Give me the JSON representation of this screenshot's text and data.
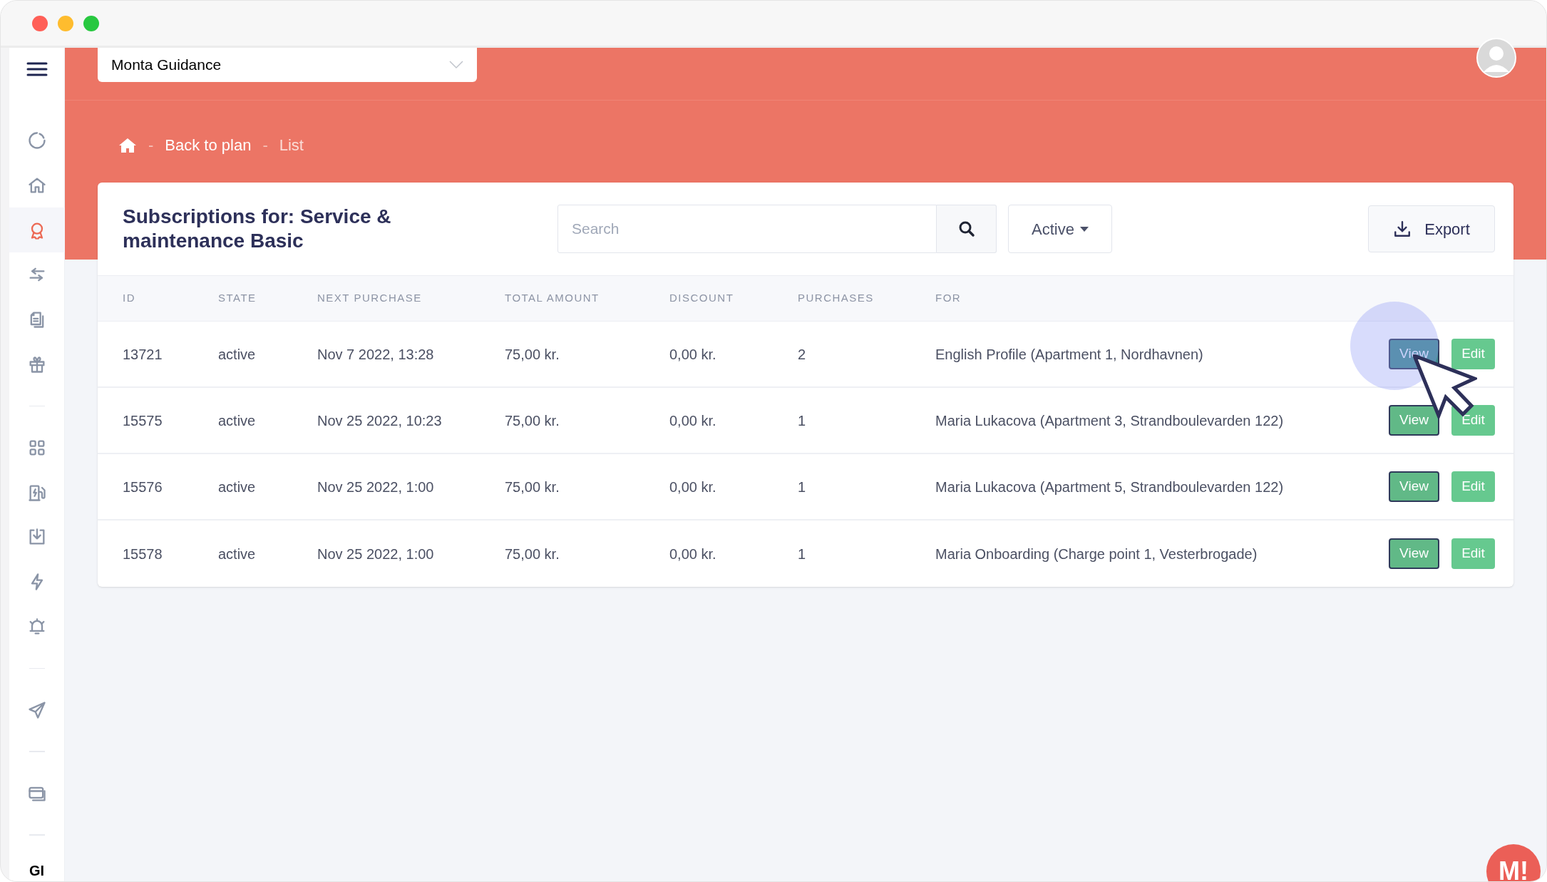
{
  "window": {
    "controls": [
      {
        "color": "#ff5f57"
      },
      {
        "color": "#febc2e"
      },
      {
        "color": "#28c840"
      }
    ]
  },
  "sidebar": {
    "items": [
      {
        "kind": "link",
        "selected": false
      },
      {
        "kind": "link",
        "selected": false
      },
      {
        "kind": "link",
        "selected": true
      },
      {
        "kind": "link",
        "selected": false
      },
      {
        "kind": "link",
        "selected": false
      },
      {
        "kind": "link",
        "selected": false
      },
      {
        "kind": "divider"
      },
      {
        "kind": "link",
        "selected": false
      },
      {
        "kind": "link",
        "selected": false
      },
      {
        "kind": "link",
        "selected": false
      },
      {
        "kind": "link",
        "selected": false
      },
      {
        "kind": "link",
        "selected": false
      },
      {
        "kind": "divider"
      },
      {
        "kind": "link",
        "selected": false
      },
      {
        "kind": "divider"
      },
      {
        "kind": "link",
        "selected": false
      },
      {
        "kind": "divider"
      },
      {
        "kind": "label",
        "label": "GI"
      }
    ]
  },
  "top_bar": {
    "project_select": {
      "value": "Monta Guidance"
    }
  },
  "breadcrumb": {
    "separator": "-",
    "items": [
      {
        "label": "Back to plan",
        "kind": "link"
      },
      {
        "label": "List",
        "kind": "current"
      }
    ]
  },
  "card": {
    "title": "Subscriptions for: Service & maintenance Basic",
    "search": {
      "placeholder": "Search"
    },
    "filter": {
      "label": "Active"
    },
    "export": {
      "label": "Export"
    }
  },
  "table": {
    "columns": [
      "ID",
      "STATE",
      "NEXT PURCHASE",
      "TOTAL AMOUNT",
      "DISCOUNT",
      "PURCHASES",
      "FOR"
    ],
    "rows": [
      {
        "cells": [
          "13721",
          "active",
          "Nov 7 2022, 13:28",
          "75,00 kr.",
          "0,00 kr.",
          "2",
          "English Profile (Apartment 1, Nordhavnen)"
        ],
        "view": {
          "label": "View",
          "hovered": true
        },
        "edit": {
          "label": "Edit"
        }
      },
      {
        "cells": [
          "15575",
          "active",
          "Nov 25 2022, 10:23",
          "75,00 kr.",
          "0,00 kr.",
          "1",
          "Maria Lukacova (Apartment 3, Strandboulevarden 122)"
        ],
        "view": {
          "label": "View",
          "hovered": false
        },
        "edit": {
          "label": "Edit"
        }
      },
      {
        "cells": [
          "15576",
          "active",
          "Nov 25 2022, 1:00",
          "75,00 kr.",
          "0,00 kr.",
          "1",
          "Maria Lukacova (Apartment 5, Strandboulevarden 122)"
        ],
        "view": {
          "label": "View",
          "hovered": false
        },
        "edit": {
          "label": "Edit"
        }
      },
      {
        "cells": [
          "15578",
          "active",
          "Nov 25 2022, 1:00",
          "75,00 kr.",
          "0,00 kr.",
          "1",
          "Maria Onboarding (Charge point 1, Vesterbrogade)"
        ],
        "view": {
          "label": "View",
          "hovered": false
        },
        "edit": {
          "label": "Edit"
        }
      }
    ]
  },
  "chat_badge": {
    "label": "M!"
  }
}
